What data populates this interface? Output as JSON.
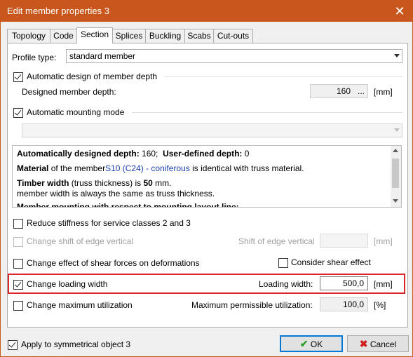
{
  "window": {
    "title": "Edit member properties 3"
  },
  "tabs": [
    {
      "label": "Topology"
    },
    {
      "label": "Code"
    },
    {
      "label": "Section"
    },
    {
      "label": "Splices"
    },
    {
      "label": "Buckling"
    },
    {
      "label": "Scabs"
    },
    {
      "label": "Cut-outs"
    }
  ],
  "active_tab": "Section",
  "profile": {
    "label": "Profile type:",
    "value": "standard member"
  },
  "auto_depth": {
    "label": "Automatic design of member depth",
    "checked": true
  },
  "designed_depth": {
    "label": "Designed member depth:",
    "value": "160",
    "ellipsis": "...",
    "unit": "[mm]"
  },
  "auto_mount": {
    "label": "Automatic mounting mode",
    "checked": true
  },
  "info": {
    "line1_bold1": "Automatically designed depth:",
    "line1_val1": " 160;",
    "line1_bold2": "User-defined depth:",
    "line1_val2": " 0",
    "line2_bold": "Material",
    "line2_pre": " of the member",
    "line2_link": "S10 (C24) - coniferous",
    "line2_post": " is identical with truss material.",
    "line3_bold": "Timber width",
    "line3_pre": " (truss thickness) is ",
    "line3_val": "50",
    "line3_post": " mm.",
    "line4": "member width is always the same as truss thickness.",
    "line5": "Member mounting with respect to mounting layout line:"
  },
  "reduce_stiffness": {
    "label": "Reduce stiffness for service classes 2 and 3",
    "checked": false
  },
  "shift_edge": {
    "label": "Change shift of edge vertical",
    "field_label": "Shift of edge vertical",
    "unit": "[mm]",
    "value": ""
  },
  "shear_forces": {
    "label": "Change effect of shear forces on deformations",
    "checked": false
  },
  "consider_shear": {
    "label": "Consider shear effect",
    "checked": false
  },
  "loading_width": {
    "label": "Change loading width",
    "checked": true,
    "field_label": "Loading width:",
    "value": "500,0",
    "unit": "[mm]"
  },
  "max_util": {
    "label": "Change maximum utilization",
    "checked": false,
    "field_label": "Maximum permissible utilization:",
    "value": "100,0",
    "unit": "[%]"
  },
  "apply_sym": {
    "label": "Apply to symmetrical object 3",
    "checked": true
  },
  "buttons": {
    "ok": "OK",
    "cancel": "Cancel"
  },
  "colors": {
    "titlebar": "#c9561c",
    "highlight": "#d9272e",
    "ok_icon": "#2e9e2e",
    "cancel_icon": "#d01c1c",
    "link": "#1a3fb0"
  }
}
